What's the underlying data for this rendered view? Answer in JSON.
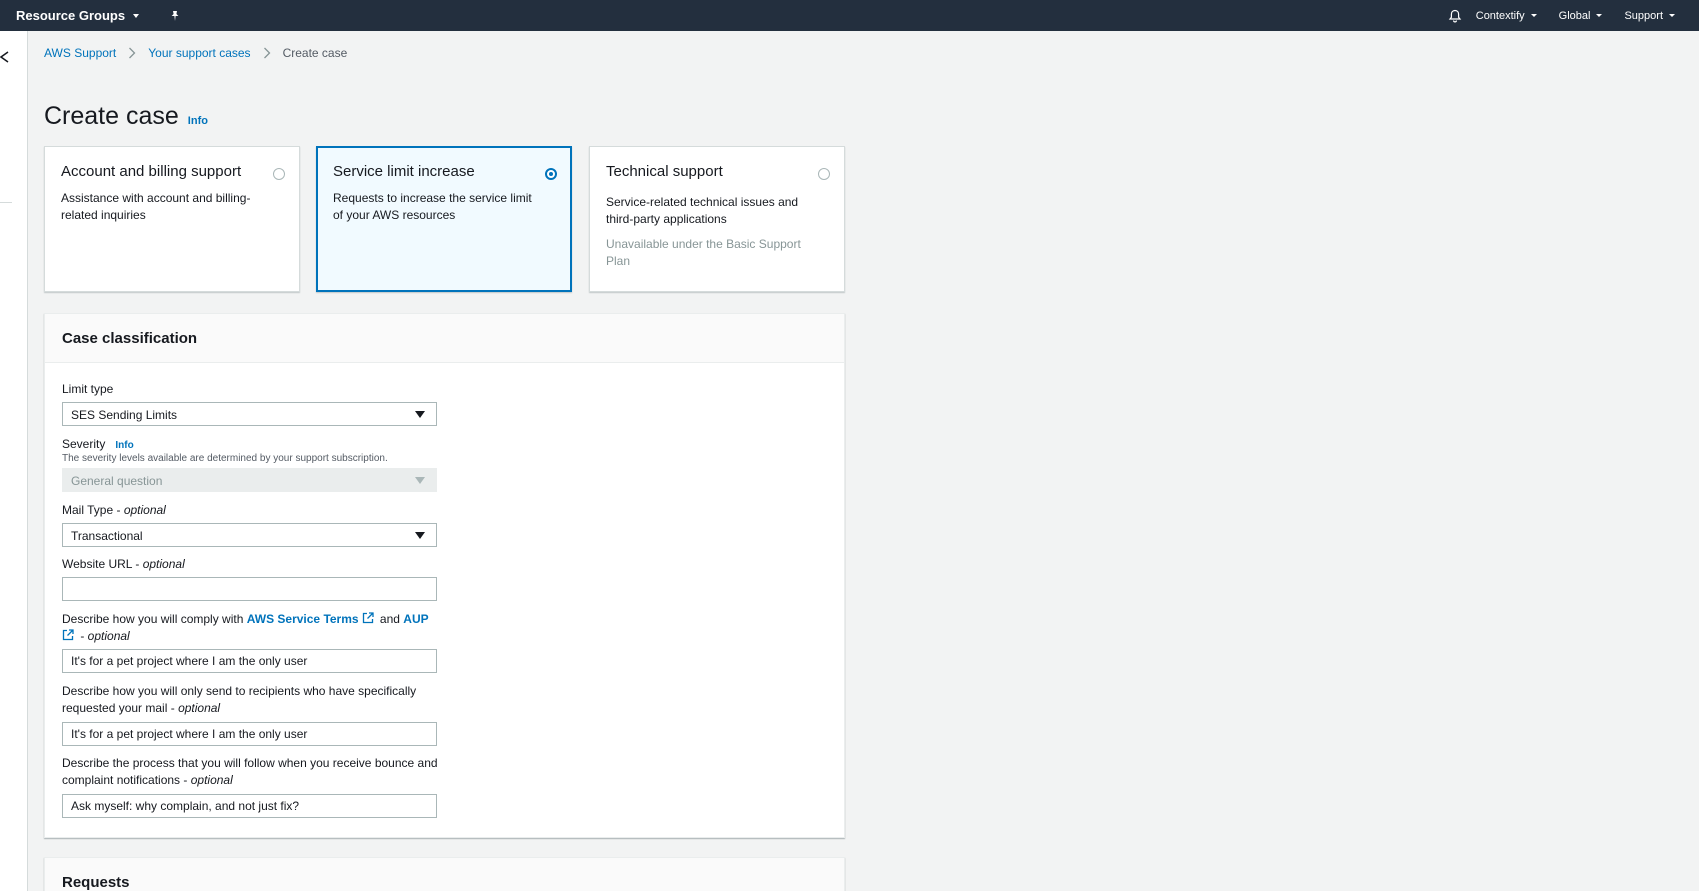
{
  "topnav": {
    "resource_groups": "Resource Groups",
    "menus": [
      "Contextify",
      "Global",
      "Support"
    ]
  },
  "breadcrumb": {
    "items": [
      "AWS Support",
      "Your support cases"
    ],
    "current": "Create case"
  },
  "page": {
    "title": "Create case",
    "info": "Info"
  },
  "tiles": [
    {
      "title": "Account and billing support",
      "desc": "Assistance with account and billing-related inquiries",
      "note": "",
      "selected": false
    },
    {
      "title": "Service limit increase",
      "desc": "Requests to increase the service limit of your AWS resources",
      "note": "",
      "selected": true
    },
    {
      "title": "Technical support",
      "desc": "Service-related technical issues and third-party applications",
      "note": "Unavailable under the Basic Support Plan",
      "selected": false
    }
  ],
  "case_classification": {
    "header": "Case classification",
    "limit_type": {
      "label": "Limit type",
      "value": "SES Sending Limits"
    },
    "severity": {
      "label": "Severity",
      "info": "Info",
      "desc": "The severity levels available are determined by your support subscription.",
      "value": "General question"
    },
    "mail_type": {
      "label": "Mail Type - ",
      "optional": "optional",
      "value": "Transactional"
    },
    "website_url": {
      "label": "Website URL - ",
      "optional": "optional",
      "value": ""
    },
    "comply": {
      "label_prefix": "Describe how you will comply with ",
      "link1": "AWS Service Terms",
      "and": " and ",
      "link2": "AUP",
      "suffix": " - ",
      "optional": "optional",
      "value": "It's for a pet project where I am the only user"
    },
    "recipients": {
      "label": "Describe how you will only send to recipients who have specifically requested your mail - ",
      "optional": "optional",
      "value": "It's for a pet project where I am the only user"
    },
    "bounce": {
      "label": "Describe the process that you will follow when you receive bounce and complaint notifications - ",
      "optional": "optional",
      "value": "Ask myself: why complain, and not just fix?"
    }
  },
  "requests": {
    "header": "Requests"
  },
  "colors": {
    "nav": "#232f3e",
    "link": "#0073bb",
    "bg": "#f2f3f3"
  }
}
